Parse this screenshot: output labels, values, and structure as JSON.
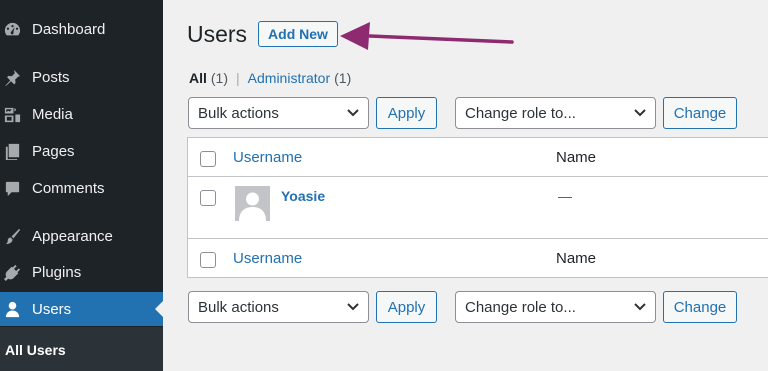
{
  "sidebar": {
    "items": [
      {
        "label": "Dashboard",
        "icon": "dashboard-icon"
      },
      {
        "label": "Posts",
        "icon": "pin-icon"
      },
      {
        "label": "Media",
        "icon": "media-icon"
      },
      {
        "label": "Pages",
        "icon": "pages-icon"
      },
      {
        "label": "Comments",
        "icon": "comment-icon"
      },
      {
        "label": "Appearance",
        "icon": "brush-icon"
      },
      {
        "label": "Plugins",
        "icon": "plugin-icon"
      },
      {
        "label": "Users",
        "icon": "user-icon"
      }
    ],
    "active": "Users",
    "submenu": {
      "label": "All Users"
    }
  },
  "header": {
    "title": "Users",
    "add_new_label": "Add New"
  },
  "filters": {
    "all_label": "All",
    "all_count": "(1)",
    "separator": "|",
    "admin_label": "Administrator",
    "admin_count": "(1)"
  },
  "top_actions": {
    "bulk_actions": "Bulk actions",
    "apply_label": "Apply",
    "change_role": "Change role to...",
    "change_label": "Change"
  },
  "table": {
    "columns": {
      "username": "Username",
      "name": "Name"
    },
    "rows": [
      {
        "username": "Yoasie",
        "name": "—"
      }
    ]
  },
  "bottom_actions": {
    "bulk_actions": "Bulk actions",
    "apply_label": "Apply",
    "change_role": "Change role to...",
    "change_label": "Change"
  },
  "colors": {
    "sidebar_bg": "#1d2327",
    "active_bg": "#2271b1",
    "link": "#2271b1",
    "annotation_arrow": "#8e2a6f"
  }
}
